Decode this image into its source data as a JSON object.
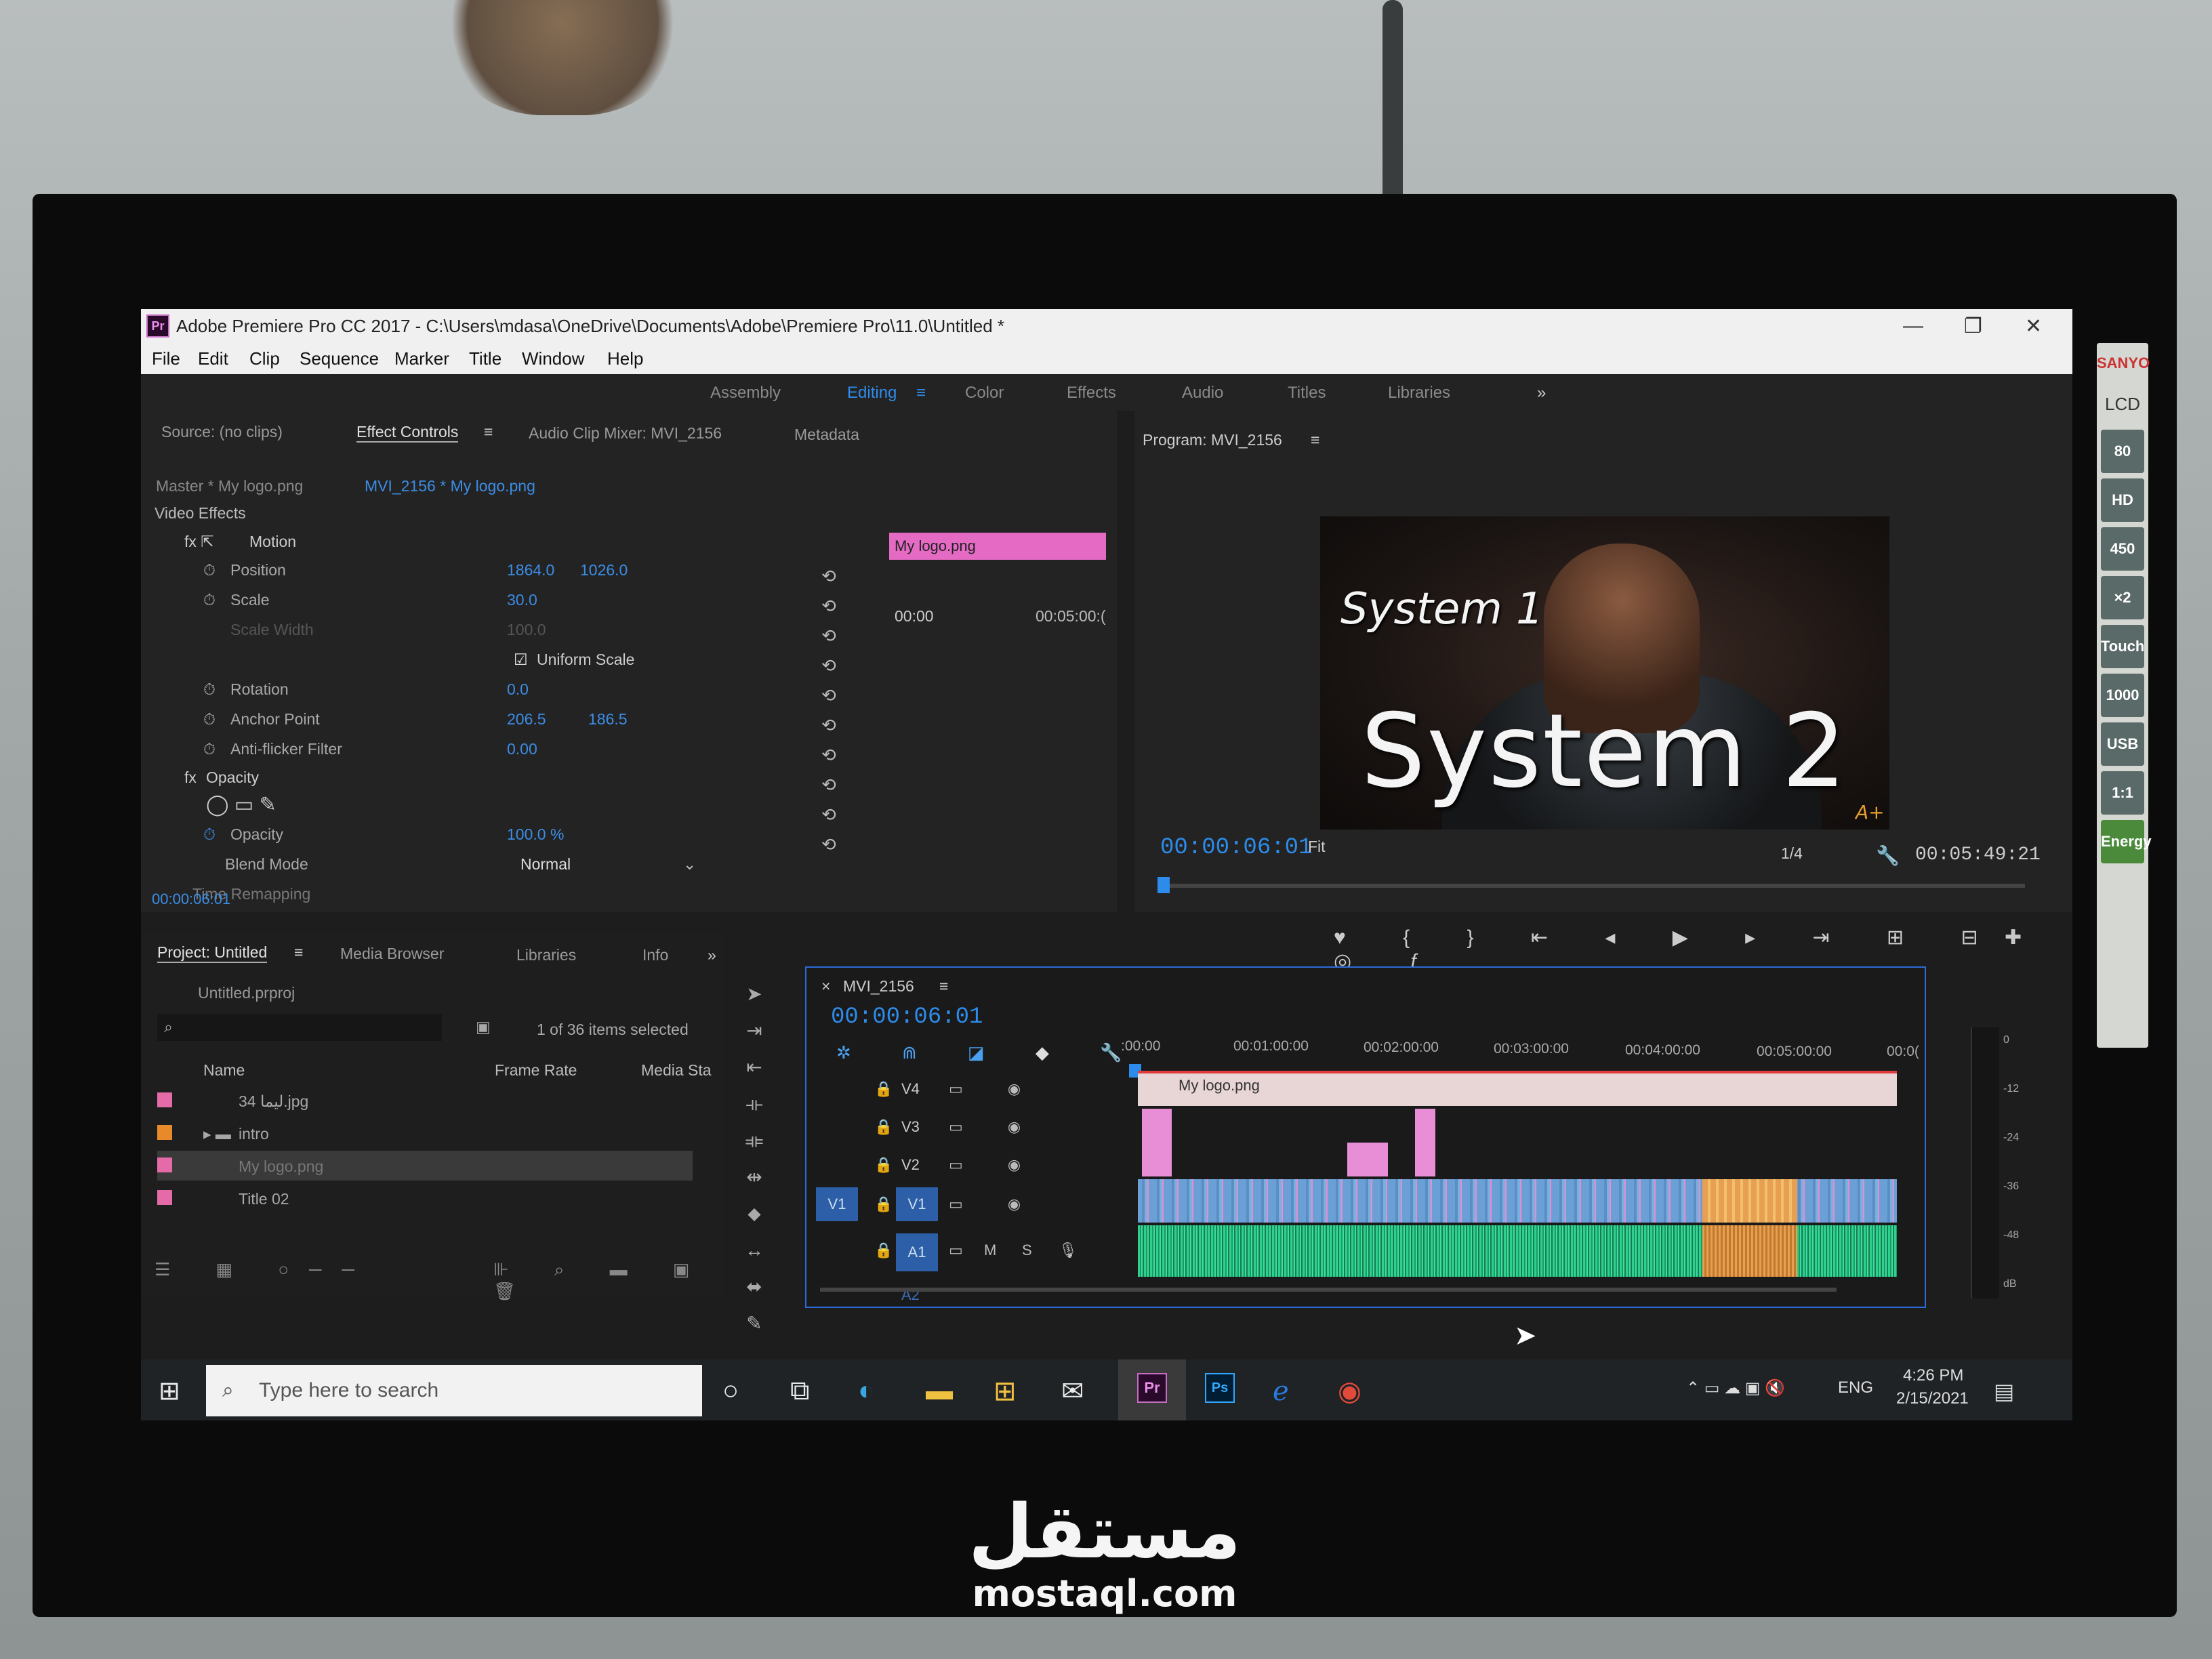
{
  "window": {
    "title": "Adobe Premiere Pro CC 2017 - C:\\Users\\mdasa\\OneDrive\\Documents\\Adobe\\Premiere Pro\\11.0\\Untitled *",
    "app_icon": "Pr",
    "controls": [
      "—",
      "❐",
      "✕"
    ]
  },
  "menu": [
    "File",
    "Edit",
    "Clip",
    "Sequence",
    "Marker",
    "Title",
    "Window",
    "Help"
  ],
  "workspaces": {
    "items": [
      "Assembly",
      "Editing",
      "Color",
      "Effects",
      "Audio",
      "Titles",
      "Libraries"
    ],
    "active": "Editing",
    "more": "»"
  },
  "source_panel": {
    "tabs": [
      "Source: (no clips)",
      "Effect Controls",
      "Audio Clip Mixer: MVI_2156",
      "Metadata"
    ],
    "master": "Master * My logo.png",
    "sequence_clip": "MVI_2156 * My logo.png",
    "ruler_start": "00:00",
    "ruler_end": "00:05:00:(",
    "clip_label": "My logo.png",
    "section_video_effects": "Video Effects",
    "motion": "Motion",
    "position_label": "Position",
    "position_x": "1864.0",
    "position_y": "1026.0",
    "scale_label": "Scale",
    "scale_value": "30.0",
    "scale_width_label": "Scale Width",
    "scale_width_value": "100.0",
    "uniform_scale": "Uniform Scale",
    "rotation_label": "Rotation",
    "rotation_value": "0.0",
    "anchor_label": "Anchor Point",
    "anchor_x": "206.5",
    "anchor_y": "186.5",
    "antiflicker_label": "Anti-flicker Filter",
    "antiflicker_value": "0.00",
    "opacity_section": "Opacity",
    "opacity_label": "Opacity",
    "opacity_value": "100.0 %",
    "blend_label": "Blend Mode",
    "blend_value": "Normal",
    "time_remap": "Time Remapping",
    "timecode": "00:00:06:01"
  },
  "program_panel": {
    "title": "Program: MVI_2156",
    "overlay_small": "System 1",
    "overlay_large": "System 2",
    "watermark_logo": "A+",
    "timecode": "00:00:06:01",
    "fit": "Fit",
    "resolution": "1/4",
    "duration": "00:05:49:21"
  },
  "project_panel": {
    "tabs": [
      "Project: Untitled",
      "Media Browser",
      "Libraries",
      "Info"
    ],
    "file": "Untitled.prproj",
    "selection": "1 of 36 items selected",
    "columns": [
      "Name",
      "Frame Rate",
      "Media Sta"
    ],
    "items": [
      {
        "name": "34 ليما.jpg",
        "color": "#e46aa8"
      },
      {
        "name": "intro",
        "color": "#e8892a"
      },
      {
        "name": "My logo.png",
        "color": "#e46aa8"
      },
      {
        "name": "Title 02",
        "color": "#e46aa8"
      }
    ]
  },
  "timeline": {
    "sequence": "MVI_2156",
    "timecode": "00:00:06:01",
    "ruler": [
      ":00:00",
      "00:01:00:00",
      "00:02:00:00",
      "00:03:00:00",
      "00:04:00:00",
      "00:05:00:00",
      "00:0("
    ],
    "tracks": [
      "V4",
      "V3",
      "V2",
      "V1",
      "A1",
      "A2"
    ],
    "source_patch_v": "V1",
    "logo_clip": "My logo.png",
    "mute": "M",
    "solo": "S",
    "meter_labels": [
      "0",
      "-12",
      "-24",
      "-36",
      "-48",
      "dB"
    ]
  },
  "taskbar": {
    "search_placeholder": "Type here to search",
    "lang": "ENG",
    "time": "4:26 PM",
    "date": "2/15/2021"
  },
  "monitor": {
    "brand": "SANYO",
    "lcd": "LCD",
    "badges": [
      "80",
      "HD",
      "450",
      "×2",
      "Touch",
      "1000",
      "USB",
      "1:1",
      "Energy"
    ]
  },
  "watermark": {
    "arabic": "مستقل",
    "latin": "mostaql.com"
  }
}
